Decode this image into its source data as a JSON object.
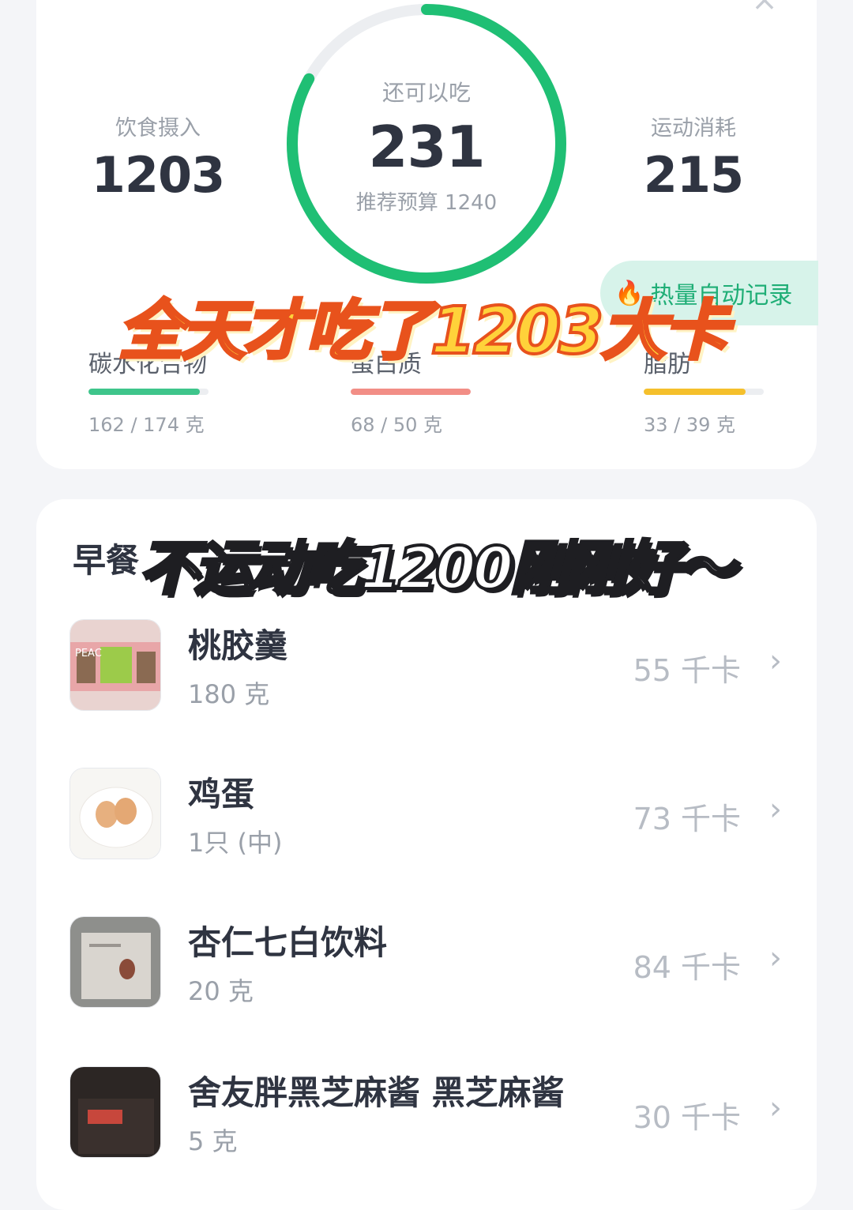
{
  "summary": {
    "intake_label": "饮食摄入",
    "intake_value": "1203",
    "remaining_label": "还可以吃",
    "remaining_value": "231",
    "budget_text": "推荐预算 1240",
    "burn_label": "运动消耗",
    "burn_value": "215",
    "ring_progress": 0.83,
    "auto_record_label": "热量自动记录"
  },
  "macros": [
    {
      "name": "碳水化合物",
      "value": "162 / 174 克",
      "progress": 0.93,
      "color": "#3ec58b"
    },
    {
      "name": "蛋白质",
      "value": "68 / 50 克",
      "progress": 1.0,
      "color": "#f28e86"
    },
    {
      "name": "脂肪",
      "value": "33 / 39 克",
      "progress": 0.85,
      "color": "#f5c02c"
    }
  ],
  "overlays": {
    "line1": "全天才吃了1203大卡",
    "line2": "不运动吃1200刚刚好～"
  },
  "meal": {
    "title": "早餐",
    "items": [
      {
        "name": "桃胶羹",
        "amount": "180 克",
        "kcal": "55 千卡",
        "icon": "peach-gum-box-photo"
      },
      {
        "name": "鸡蛋",
        "amount": "1只 (中)",
        "kcal": "73 千卡",
        "icon": "eggs-plate-photo"
      },
      {
        "name": "杏仁七白饮料",
        "amount": "20 克",
        "kcal": "84 千卡",
        "icon": "drink-box-photo"
      },
      {
        "name": "舍友胖黑芝麻酱 黑芝麻酱",
        "amount": "5 克",
        "kcal": "30 千卡",
        "icon": "sesame-jar-photo"
      }
    ]
  },
  "colors": {
    "ring_green": "#1fbf74",
    "ring_track": "#eceef1"
  }
}
